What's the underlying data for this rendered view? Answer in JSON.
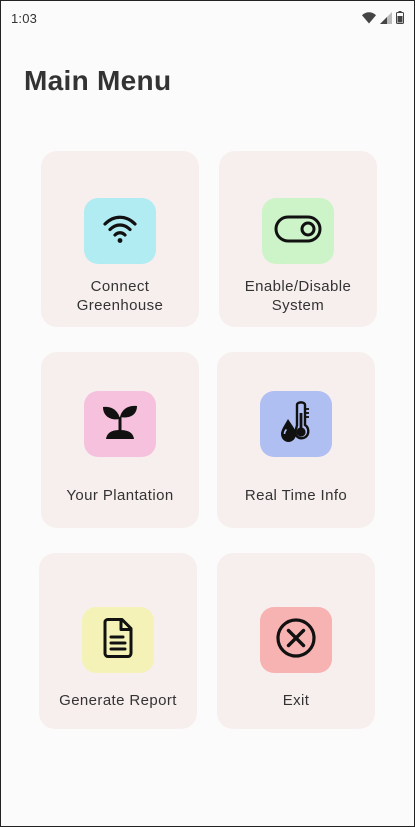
{
  "status_bar": {
    "time": "1:03",
    "icons": [
      "wifi-icon",
      "cell-signal-icon",
      "battery-icon"
    ]
  },
  "page": {
    "title": "Main Menu"
  },
  "menu": {
    "items": [
      {
        "label": "Connect\nGreenhouse",
        "icon": "wifi-icon",
        "tile_color": "#b2ecf3"
      },
      {
        "label": "Enable/Disable\nSystem",
        "icon": "toggle-icon",
        "tile_color": "#cdf4c8"
      },
      {
        "label": "Your Plantation",
        "icon": "sprout-icon",
        "tile_color": "#f5c1dc"
      },
      {
        "label": "Real Time Info",
        "icon": "thermometer-drop-icon",
        "tile_color": "#afbff2"
      },
      {
        "label": "Generate Report",
        "icon": "document-icon",
        "tile_color": "#f4f2b6"
      },
      {
        "label": "Exit",
        "icon": "close-circle-icon",
        "tile_color": "#f7b2b2"
      }
    ]
  },
  "colors": {
    "background": "#fbfbfb",
    "card": "#f7efed",
    "text": "#333333"
  }
}
